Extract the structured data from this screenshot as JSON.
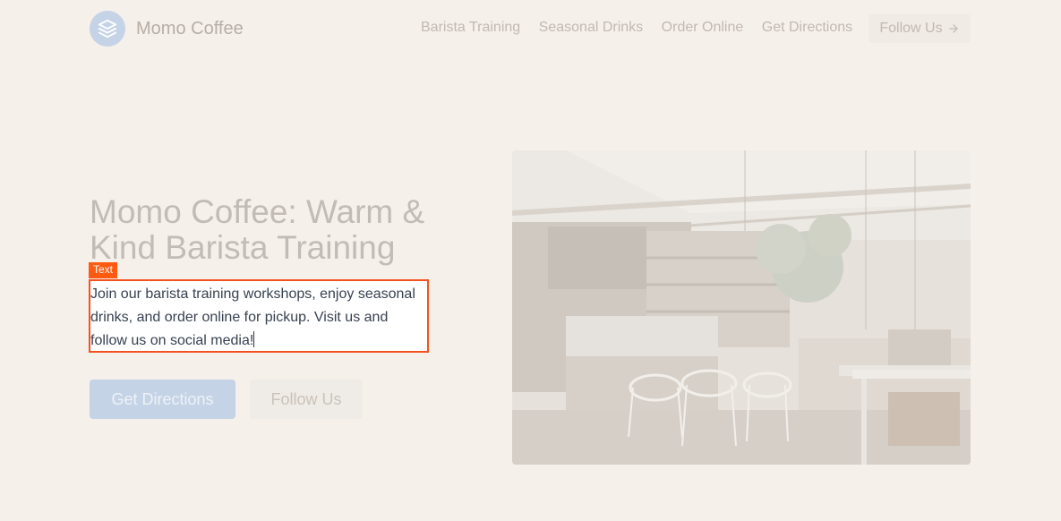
{
  "nav": {
    "brand": "Momo Coffee",
    "links": [
      "Barista Training",
      "Seasonal Drinks",
      "Order Online",
      "Get Directions"
    ],
    "follow_label": "Follow Us"
  },
  "hero": {
    "title": "Momo Coffee: Warm & Kind Barista Training",
    "tag": "Text",
    "description": "Join our barista training workshops, enjoy seasonal drinks, and order online for pickup. Visit us and follow us on social media!",
    "primary_button": "Get Directions",
    "secondary_button": "Follow Us"
  },
  "icons": {
    "logo": "layers-icon",
    "follow_arrow": "arrow-right-icon",
    "hero_image": "coffee-shop-interior-image"
  },
  "colors": {
    "background": "#f5f0ea",
    "accent": "#c4d3e6",
    "selection": "#ff5a12"
  }
}
